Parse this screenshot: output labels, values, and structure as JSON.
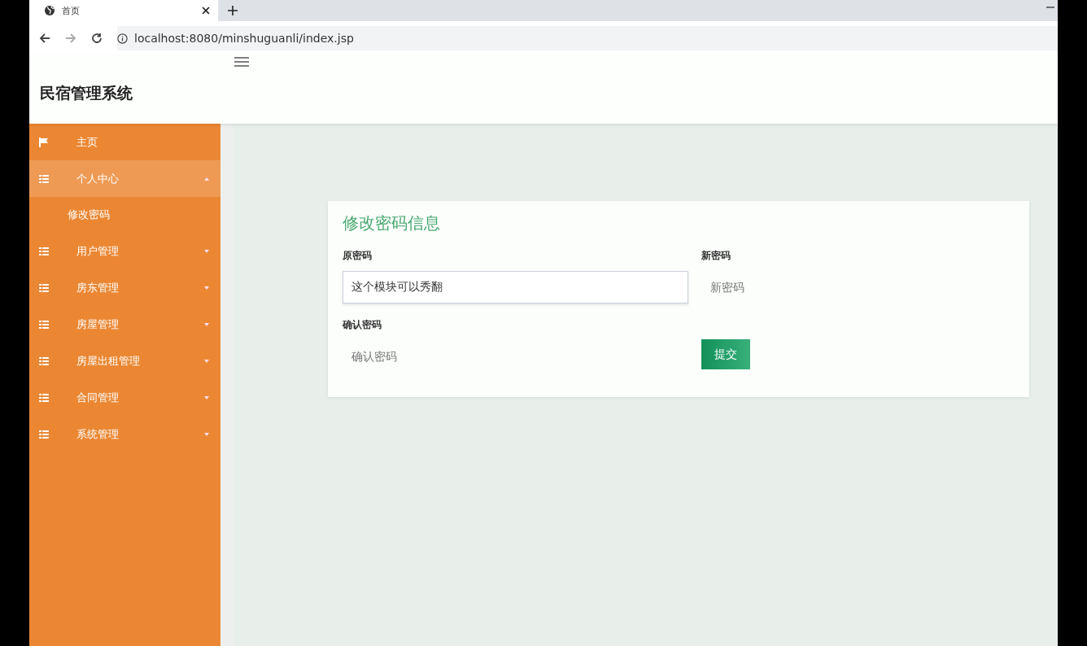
{
  "browser": {
    "tab": {
      "title": "首页"
    },
    "url": "localhost:8080/minshuguanli/index.jsp"
  },
  "app": {
    "title": "民宿管理系统"
  },
  "sidebar": {
    "items": [
      {
        "label": "主页",
        "kind": "flag",
        "selected": false
      },
      {
        "label": "个人中心",
        "kind": "grid",
        "expanded": true,
        "selected": true,
        "children": [
          {
            "label": "修改密码"
          }
        ]
      },
      {
        "label": "用户管理",
        "kind": "grid",
        "expanded": false,
        "selected": false
      },
      {
        "label": "房东管理",
        "kind": "grid",
        "expanded": false,
        "selected": false
      },
      {
        "label": "房屋管理",
        "kind": "grid",
        "expanded": false,
        "selected": false
      },
      {
        "label": "房屋出租管理",
        "kind": "grid",
        "expanded": false,
        "selected": false
      },
      {
        "label": "合同管理",
        "kind": "grid",
        "expanded": false,
        "selected": false
      },
      {
        "label": "系统管理",
        "kind": "grid",
        "expanded": false,
        "selected": false
      }
    ]
  },
  "form": {
    "title": "修改密码信息",
    "fields": [
      {
        "label": "原密码",
        "value": "这个模块可以秀翻",
        "focused": true
      },
      {
        "label": "新密码",
        "placeholder": "新密码",
        "focused": false
      },
      {
        "label": "确认密码",
        "placeholder": "确认密码",
        "focused": false
      }
    ],
    "submit": "提交"
  }
}
